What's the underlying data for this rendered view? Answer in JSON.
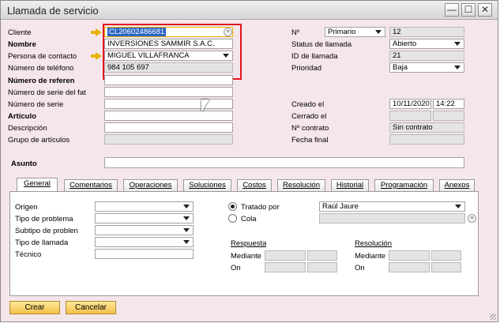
{
  "window": {
    "title": "Llamada de servicio",
    "minimize_glyph": "—",
    "maximize_glyph": "☐",
    "close_glyph": "✕"
  },
  "header_left": {
    "cliente": {
      "label": "Cliente",
      "value": "CL20602486681"
    },
    "nombre": {
      "label": "Nombre",
      "value": "INVERSIONES SAMMIR S.A.C."
    },
    "persona_contacto": {
      "label": "Persona de contacto",
      "value": "MIGUEL VILLAFRANCA"
    },
    "telefono": {
      "label": "Número de teléfono",
      "value": "984 105 697"
    },
    "numero_referencia": {
      "label": "Número de referen",
      "value": ""
    },
    "numero_serie_fab": {
      "label": "Número de serie del fat",
      "value": ""
    },
    "numero_serie": {
      "label": "Número de serie",
      "value": ""
    },
    "articulo": {
      "label": "Artículo",
      "value": ""
    },
    "descripcion": {
      "label": "Descripción",
      "value": ""
    },
    "grupo_articulos": {
      "label": "Grupo de artículos",
      "value": ""
    }
  },
  "header_right": {
    "numero": {
      "label": "Nº",
      "series": "Primario",
      "value": "12"
    },
    "status": {
      "label": "Status de llamada",
      "value": "Abierto"
    },
    "id_llamada": {
      "label": "ID de llamada",
      "value": "21"
    },
    "prioridad": {
      "label": "Prioridad",
      "value": "Baja"
    },
    "creado_el": {
      "label": "Creado el",
      "date": "10/11/2020",
      "time": "14:22"
    },
    "cerrado_el": {
      "label": "Cerrado el",
      "date": "",
      "time": ""
    },
    "no_contrato": {
      "label": "Nº contrato",
      "value": "Sin contrato"
    },
    "fecha_final": {
      "label": "Fecha final",
      "value": ""
    }
  },
  "asunto": {
    "label": "Asunto",
    "value": ""
  },
  "tabs": [
    {
      "label": "General",
      "active": true
    },
    {
      "label": "Comentarios",
      "active": false
    },
    {
      "label": "Operaciones",
      "active": false
    },
    {
      "label": "Soluciones",
      "active": false
    },
    {
      "label": "Costos",
      "active": false
    },
    {
      "label": "Resolución",
      "active": false
    },
    {
      "label": "Historial",
      "active": false
    },
    {
      "label": "Programación",
      "active": false
    },
    {
      "label": "Anexos",
      "active": false
    }
  ],
  "general": {
    "origen": {
      "label": "Origen",
      "value": ""
    },
    "tipo_problema": {
      "label": "Tipo de problema",
      "value": ""
    },
    "subtipo_problema": {
      "label": "Subtipo de problen",
      "value": ""
    },
    "tipo_llamada": {
      "label": "Tipo de llamada",
      "value": ""
    },
    "tecnico": {
      "label": "Técnico",
      "value": ""
    },
    "tratado_por": {
      "label": "Tratado por",
      "value": "Raúl Jaure",
      "selected": true
    },
    "cola": {
      "label": "Cola",
      "value": "",
      "selected": false
    },
    "respuesta": {
      "heading": "Respuesta",
      "mediante_label": "Mediante",
      "on_label": "On"
    },
    "resolucion": {
      "heading": "Resolución",
      "mediante_label": "Mediante",
      "on_label": "On"
    }
  },
  "buttons": {
    "crear": "Crear",
    "cancelar": "Cancelar"
  },
  "colors": {
    "form_bg": "#f5e6ec",
    "highlight_box": "#e0161b",
    "button_yellow": "#f2c14b",
    "selection_blue": "#2a66c3"
  }
}
